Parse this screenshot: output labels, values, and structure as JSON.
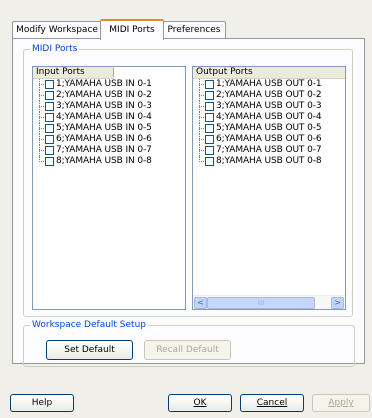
{
  "tabs": [
    {
      "label": "Modify Workspace",
      "active": false
    },
    {
      "label": "MIDI Ports",
      "active": true
    },
    {
      "label": "Preferences",
      "active": false
    }
  ],
  "midi_ports": {
    "group_label": "MIDI Ports",
    "input": {
      "header": "Input Ports",
      "items": [
        {
          "label": "1;YAMAHA USB IN 0-1",
          "checked": false
        },
        {
          "label": "2;YAMAHA USB IN 0-2",
          "checked": false
        },
        {
          "label": "3;YAMAHA USB IN 0-3",
          "checked": false
        },
        {
          "label": "4;YAMAHA USB IN 0-4",
          "checked": false
        },
        {
          "label": "5;YAMAHA USB IN 0-5",
          "checked": false
        },
        {
          "label": "6;YAMAHA USB IN 0-6",
          "checked": false
        },
        {
          "label": "7;YAMAHA USB IN 0-7",
          "checked": false
        },
        {
          "label": "8;YAMAHA USB IN 0-8",
          "checked": false
        }
      ]
    },
    "output": {
      "header": "Output Ports",
      "items": [
        {
          "label": "1;YAMAHA USB OUT 0-1",
          "checked": false
        },
        {
          "label": "2;YAMAHA USB OUT 0-2",
          "checked": false
        },
        {
          "label": "3;YAMAHA USB OUT 0-3",
          "checked": false
        },
        {
          "label": "4;YAMAHA USB OUT 0-4",
          "checked": false
        },
        {
          "label": "5;YAMAHA USB OUT 0-5",
          "checked": false
        },
        {
          "label": "6;YAMAHA USB OUT 0-6",
          "checked": false
        },
        {
          "label": "7;YAMAHA USB OUT 0-7",
          "checked": false
        },
        {
          "label": "8;YAMAHA USB OUT 0-8",
          "checked": false
        }
      ],
      "scroll_left_glyph": "<",
      "scroll_right_glyph": ">",
      "scroll_thumb_glyph": "III"
    }
  },
  "workspace_default": {
    "group_label": "Workspace Default Setup",
    "set_default_label": "Set Default",
    "recall_default_label": "Recall Default"
  },
  "footer": {
    "help_label": "Help",
    "ok_label": "OK",
    "cancel_label": "Cancel",
    "apply_label": "Apply"
  },
  "colors": {
    "tab_active_accent": "#e68b2c",
    "group_label": "#0046d5",
    "list_border": "#7f9db9",
    "button_border": "#003c74"
  }
}
